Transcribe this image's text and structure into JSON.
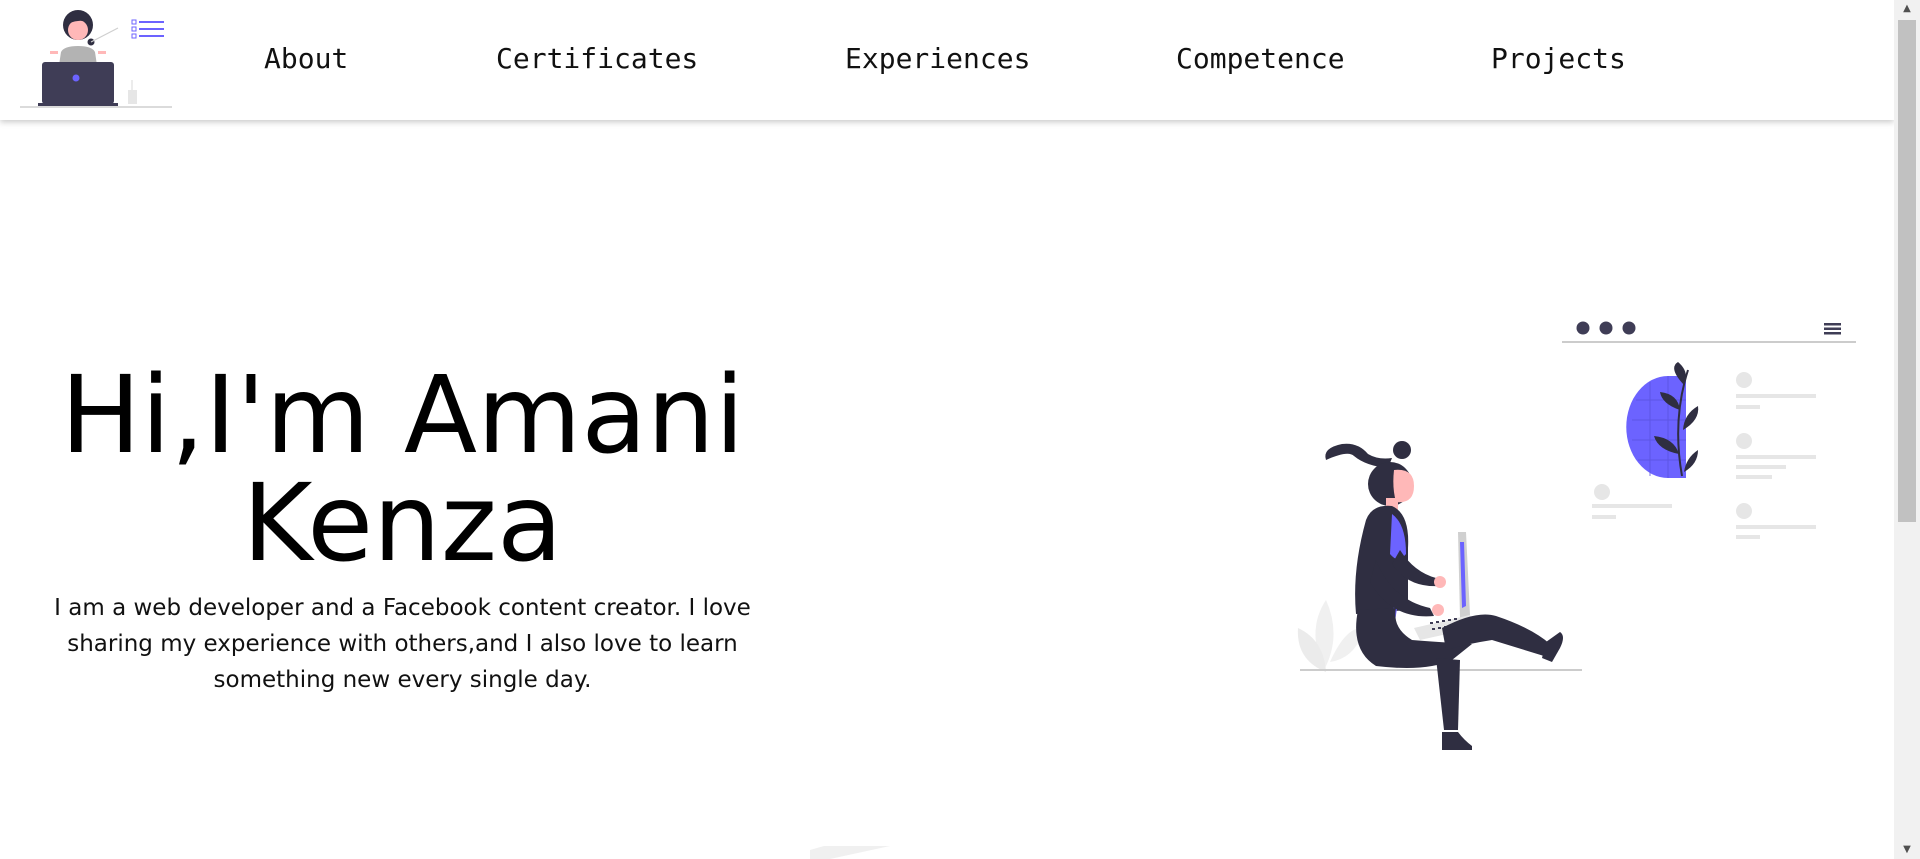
{
  "nav": {
    "links": [
      {
        "label": "About"
      },
      {
        "label": "Certificates"
      },
      {
        "label": "Experiences"
      },
      {
        "label": "Competence"
      },
      {
        "label": "Projects"
      }
    ]
  },
  "hero": {
    "title": "Hi,I'm Amani Kenza",
    "description": "I am a web developer and a Facebook content creator. I love sharing my experience with others,and I also love to learn something new every single day."
  },
  "icons": {
    "logo": "woman-at-laptop-logo",
    "illustration": "woman-with-laptop-illustration",
    "menu": "hamburger-menu-icon"
  },
  "colors": {
    "accent": "#6c63ff",
    "dark": "#2f2e41",
    "skin": "#ffb8b8",
    "light_gray": "#e6e6e6"
  }
}
